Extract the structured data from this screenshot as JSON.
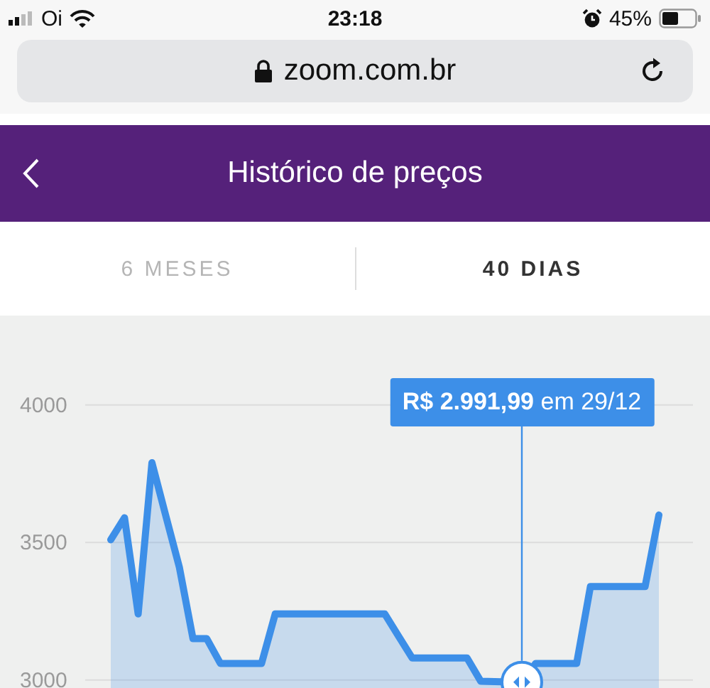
{
  "status_bar": {
    "carrier": "Oi",
    "time": "23:18",
    "battery": "45%"
  },
  "address_bar": {
    "url": "zoom.com.br"
  },
  "header": {
    "title": "Histórico de preços"
  },
  "tabs": [
    {
      "label": "6 MESES",
      "selected": false
    },
    {
      "label": "40 DIAS",
      "selected": true
    }
  ],
  "chart_data": {
    "type": "area",
    "categories": [
      null,
      null,
      null,
      null,
      null,
      null,
      null,
      null,
      null,
      null,
      null,
      null,
      null,
      null,
      null,
      null,
      null,
      null,
      null,
      null,
      null,
      null,
      null,
      null,
      null,
      null,
      null,
      null,
      null,
      null,
      null,
      null,
      null,
      null,
      null,
      null,
      null,
      null,
      null,
      null,
      null
    ],
    "series": [
      {
        "color": "#3d8fe8",
        "values": [
          3510,
          3590,
          3240,
          3790,
          3600,
          3410,
          3150,
          3150,
          3060,
          3060,
          3060,
          3060,
          3240,
          3240,
          3240,
          3240,
          3240,
          3240,
          3240,
          3240,
          3240,
          3160,
          3080,
          3080,
          3080,
          3080,
          3080,
          2995,
          2994,
          2993,
          2992,
          3060,
          3060,
          3060,
          3060,
          3340,
          3340,
          3340,
          3340,
          3340,
          3600
        ]
      }
    ],
    "ylim": [
      2950,
      4325
    ],
    "grid": true,
    "yticks": [
      {
        "value": 3000,
        "label": "3000"
      },
      {
        "value": 3500,
        "label": "3500"
      },
      {
        "value": 4000,
        "label": "4000"
      }
    ]
  },
  "tooltip": {
    "text": "**R$ 2.991,99** em 29/12"
  }
}
